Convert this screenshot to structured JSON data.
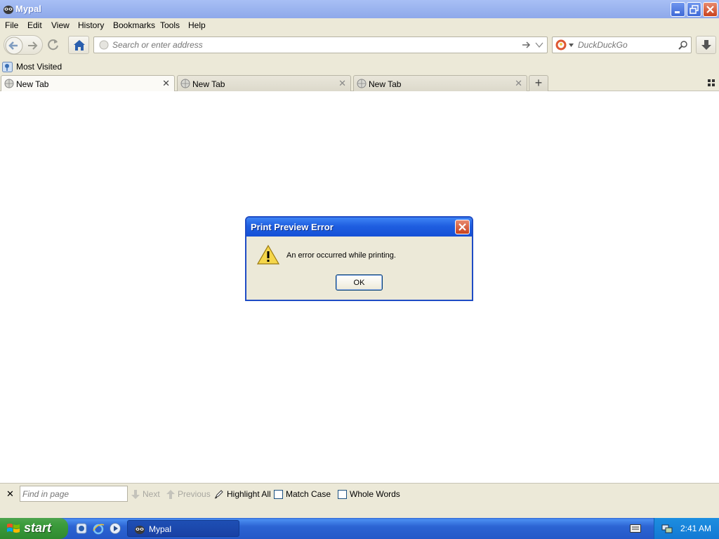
{
  "window": {
    "title": "Mypal"
  },
  "menu": [
    "File",
    "Edit",
    "View",
    "History",
    "Bookmarks",
    "Tools",
    "Help"
  ],
  "nav": {
    "url_placeholder": "Search or enter address",
    "search_placeholder": "DuckDuckGo"
  },
  "bookmarks": {
    "most_visited": "Most Visited"
  },
  "tabs": [
    {
      "label": "New Tab",
      "active": true
    },
    {
      "label": "New Tab",
      "active": false
    },
    {
      "label": "New Tab",
      "active": false
    }
  ],
  "dialog": {
    "title": "Print Preview Error",
    "message": "An error occurred while printing.",
    "ok": "OK"
  },
  "findbar": {
    "placeholder": "Find in page",
    "next": "Next",
    "previous": "Previous",
    "highlight_all": "Highlight All",
    "match_case": "Match Case",
    "whole_words": "Whole Words"
  },
  "taskbar": {
    "start": "start",
    "task": "Mypal",
    "clock": "2:41 AM"
  },
  "colors": {
    "title_active": "#1f5ee0",
    "window_face": "#ece9d8",
    "start_green": "#3c9c3c",
    "taskbar_blue": "#2458c8"
  }
}
